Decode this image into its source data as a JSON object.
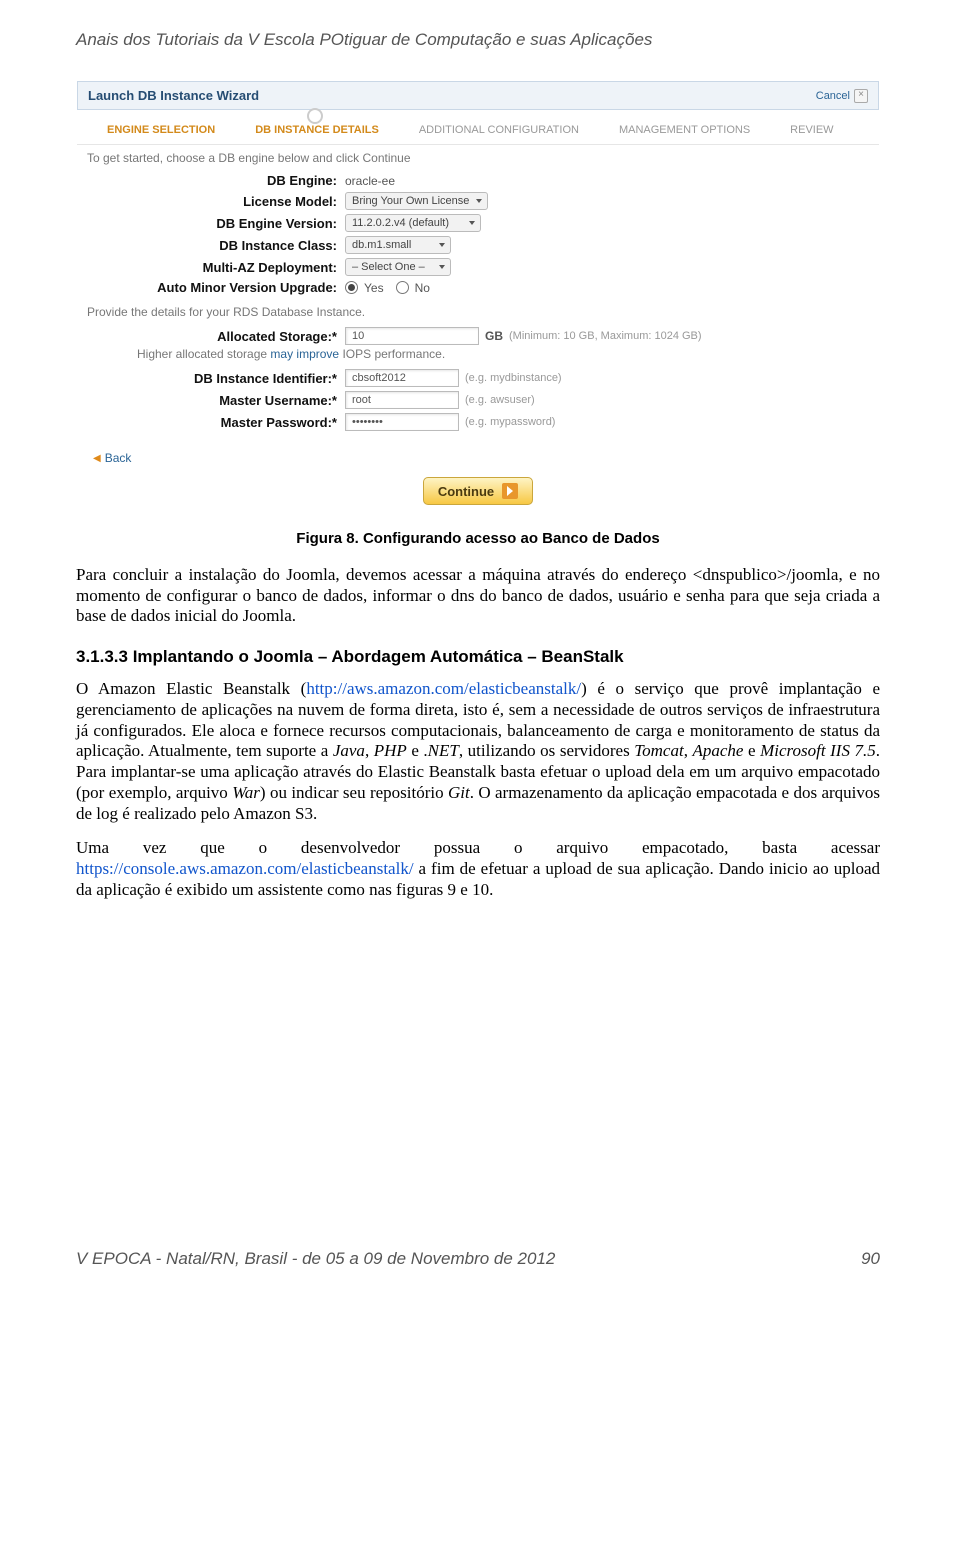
{
  "header": "Anais dos Tutoriais da V Escola POtiguar de Computação e suas Aplicações",
  "wizard": {
    "title": "Launch DB Instance Wizard",
    "cancel": "Cancel",
    "steps": {
      "s1": "ENGINE SELECTION",
      "s2": "DB INSTANCE DETAILS",
      "s3": "ADDITIONAL CONFIGURATION",
      "s4": "MANAGEMENT OPTIONS",
      "s5": "REVIEW"
    },
    "instr": "To get started, choose a DB engine below and click Continue",
    "labels": {
      "dbengine": "DB Engine:",
      "license": "License Model:",
      "version": "DB Engine Version:",
      "cls": "DB Instance Class:",
      "multiaz": "Multi-AZ Deployment:",
      "autominor": "Auto Minor Version Upgrade:",
      "details_hint": "Provide the details for your RDS Database Instance.",
      "storage": "Allocated Storage:*",
      "gb": "GB",
      "storage_hint": "(Minimum: 10 GB, Maximum: 1024 GB)",
      "iops_a": "Higher allocated storage ",
      "iops_b": "may improve",
      "iops_c": " IOPS performance.",
      "dbid": "DB Instance Identifier:*",
      "dbid_hint": "(e.g. mydbinstance)",
      "muser": "Master Username:*",
      "muser_hint": "(e.g. awsuser)",
      "mpass": "Master Password:*",
      "mpass_hint": "(e.g. mypassword)"
    },
    "values": {
      "dbengine": "oracle-ee",
      "license": "Bring Your Own License",
      "version": "11.2.0.2.v4 (default)",
      "cls": "db.m1.small",
      "multiaz": "– Select One –",
      "yes": "Yes",
      "no": "No",
      "storage": "10",
      "dbid": "cbsoft2012",
      "muser": "root",
      "mpass": "••••••••"
    },
    "back": "Back",
    "continue": "Continue"
  },
  "caption": "Figura 8. Configurando acesso ao Banco de Dados",
  "p1": "Para concluir a instalação do Joomla, devemos acessar a máquina através do endereço <dnspublico>/joomla, e no momento de configurar o banco de dados, informar o dns do banco de dados, usuário e senha para que seja criada a base de dados inicial do Joomla.",
  "h3": "3.1.3.3 Implantando o Joomla – Abordagem Automática – BeanStalk",
  "p2a": "O Amazon Elastic Beanstalk (",
  "p2link1": "http://aws.amazon.com/elasticbeanstalk/",
  "p2b": ") é o serviço que provê implantação e gerenciamento de aplicações na nuvem de forma direta, isto é, sem a necessidade de outros serviços de infraestrutura já configurados. Ele aloca e fornece recursos computacionais, balanceamento de carga e monitoramento de status da aplicação. Atualmente, tem suporte a ",
  "p2i1": "Java",
  "p2c": ", ",
  "p2i2": "PHP",
  "p2d": " e .",
  "p2i3": "NET",
  "p2e": ", utilizando os servidores ",
  "p2i4": "Tomcat",
  "p2f": ", ",
  "p2i5": "Apache",
  "p2g": " e ",
  "p2i6": "Microsoft IIS 7.5",
  "p2h": ". Para implantar-se uma aplicação através do Elastic Beanstalk basta efetuar o upload dela em um arquivo empacotado (por exemplo, arquivo ",
  "p2i7": "War",
  "p2i": ") ou indicar seu repositório ",
  "p2i8": "Git",
  "p2j": ". O armazenamento da aplicação empacotada e dos arquivos de log é realizado pelo Amazon S3.",
  "p3a": "Uma vez que o desenvolvedor possua o arquivo empacotado, basta acessar ",
  "p3link": "https://console.aws.amazon.com/elasticbeanstalk/",
  "p3b": " a fim de efetuar a upload de sua aplicação. Dando inicio ao upload da aplicação é exibido um assistente como nas figuras 9 e 10.",
  "footer": {
    "left": "V EPOCA - Natal/RN, Brasil - de 05 a 09 de Novembro de 2012",
    "right": "90"
  }
}
